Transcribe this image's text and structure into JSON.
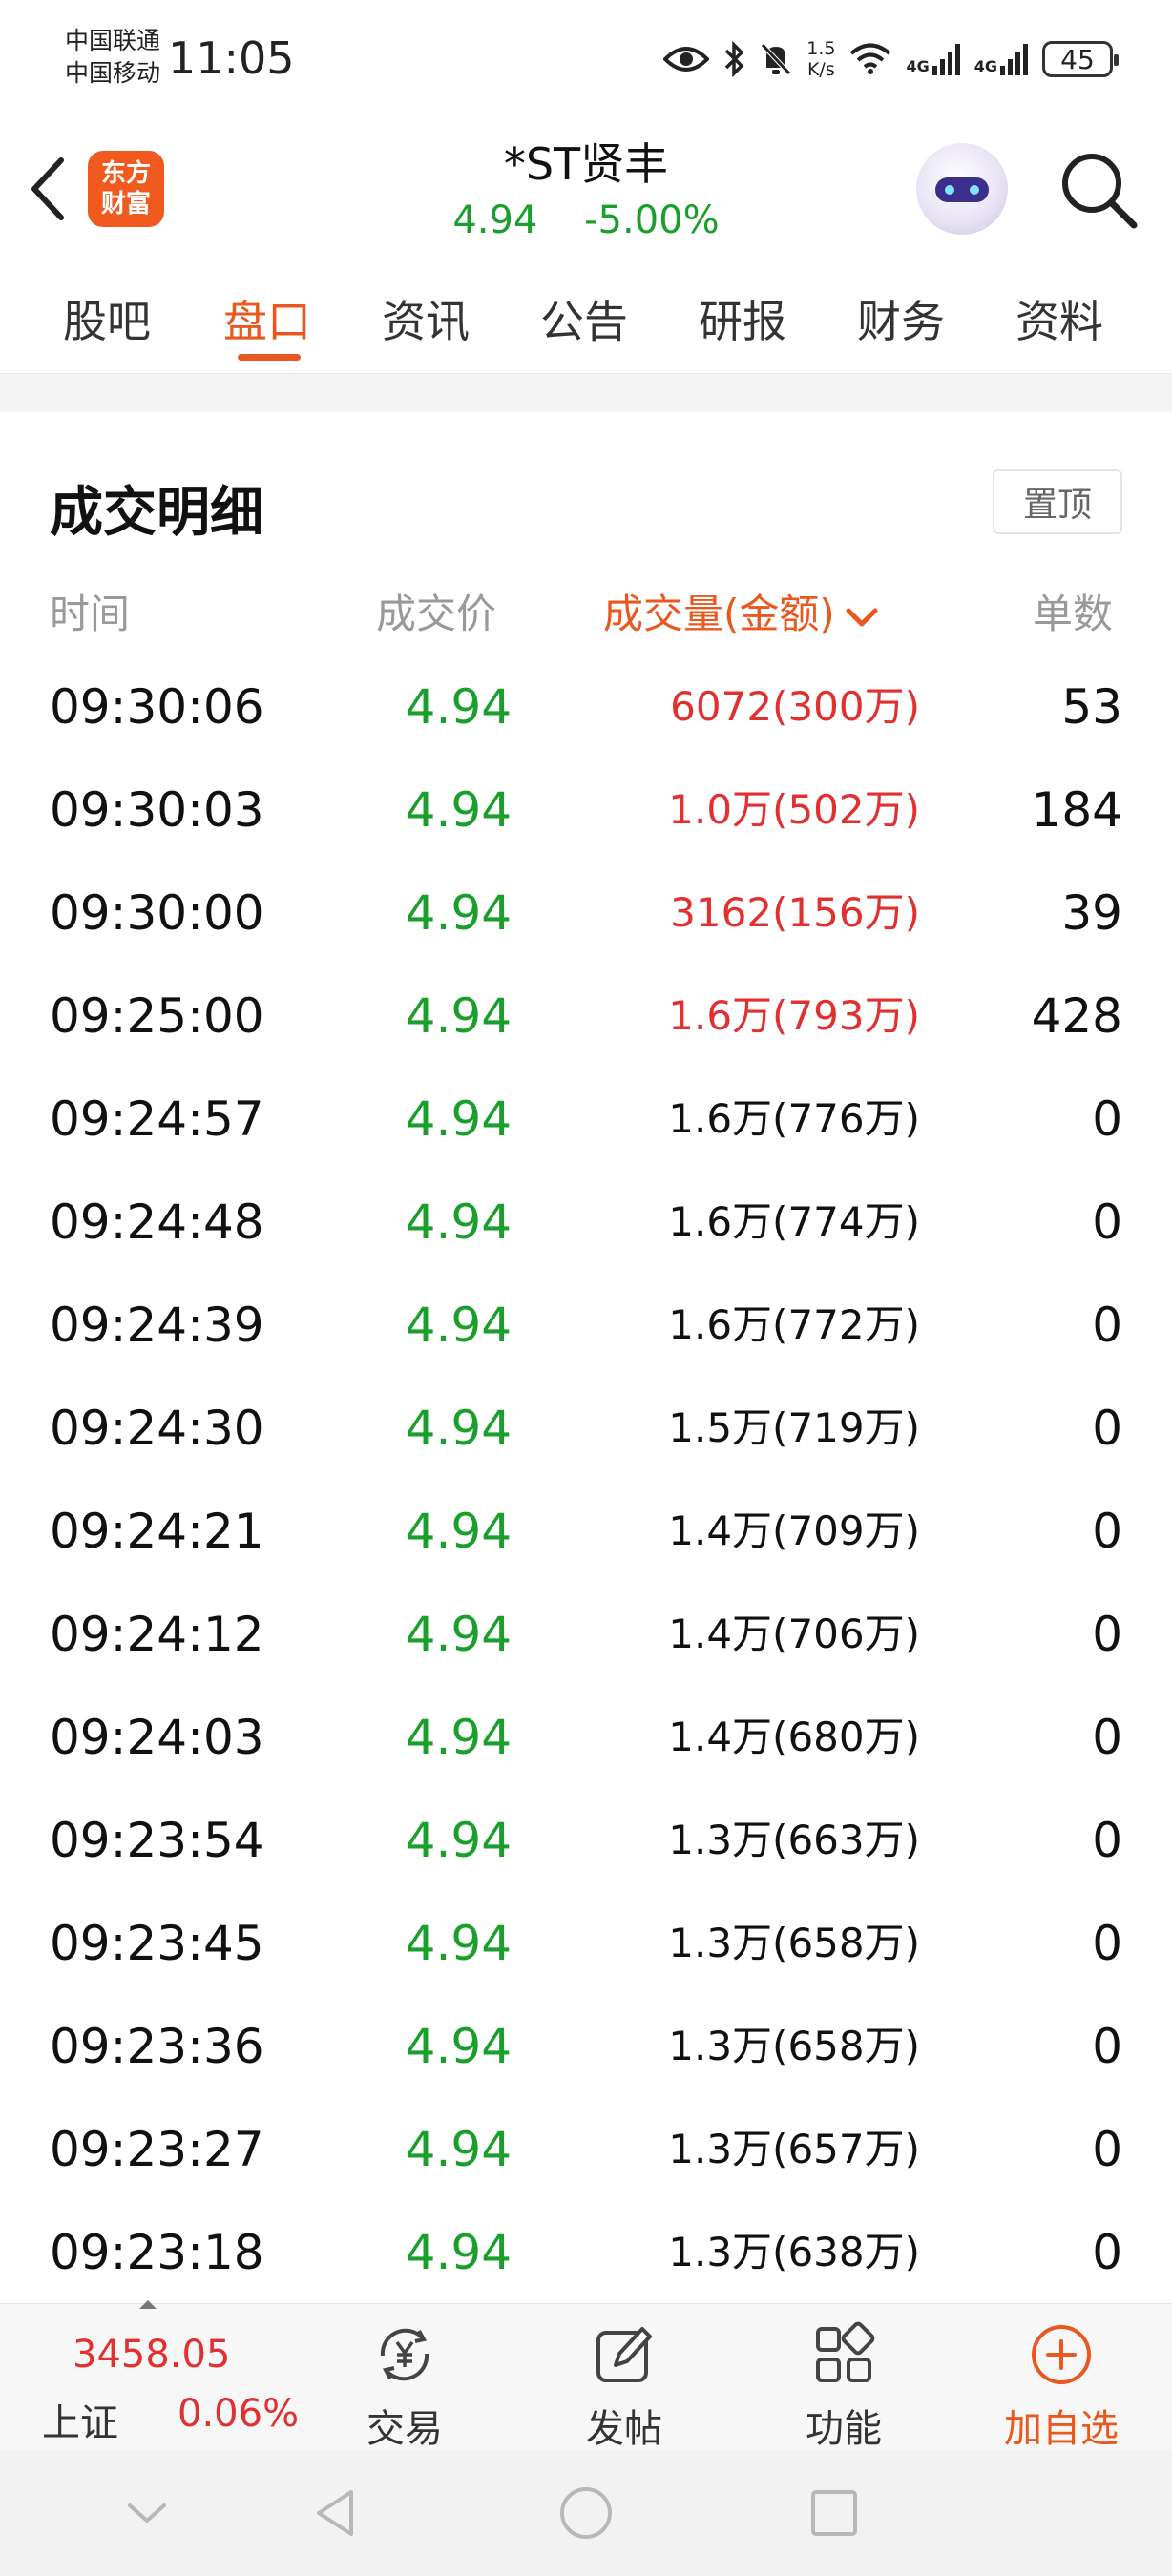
{
  "status_bar": {
    "carrier1": "中国联通",
    "carrier2": "中国移动",
    "time": "11:05",
    "net_speed_value": "1.5",
    "net_speed_unit": "K/s",
    "signal1_label": "4G",
    "signal2_label": "4G",
    "battery": "45"
  },
  "header": {
    "logo_line1": "东方",
    "logo_line2": "财富",
    "stock_name": "*ST贤丰",
    "price": "4.94",
    "change_pct": "-5.00%"
  },
  "tabs": [
    "股吧",
    "盘口",
    "资讯",
    "公告",
    "研报",
    "财务",
    "资料"
  ],
  "active_tab": "盘口",
  "section": {
    "title": "成交明细",
    "pin_label": "置顶",
    "columns": {
      "time": "时间",
      "price": "成交价",
      "volume": "成交量(金额)",
      "count": "单数"
    }
  },
  "trades": [
    {
      "time": "09:30:06",
      "price": "4.94",
      "volume": "6072(300万)",
      "count": "53",
      "highlight": true
    },
    {
      "time": "09:30:03",
      "price": "4.94",
      "volume": "1.0万(502万)",
      "count": "184",
      "highlight": true
    },
    {
      "time": "09:30:00",
      "price": "4.94",
      "volume": "3162(156万)",
      "count": "39",
      "highlight": true
    },
    {
      "time": "09:25:00",
      "price": "4.94",
      "volume": "1.6万(793万)",
      "count": "428",
      "highlight": true
    },
    {
      "time": "09:24:57",
      "price": "4.94",
      "volume": "1.6万(776万)",
      "count": "0",
      "highlight": false
    },
    {
      "time": "09:24:48",
      "price": "4.94",
      "volume": "1.6万(774万)",
      "count": "0",
      "highlight": false
    },
    {
      "time": "09:24:39",
      "price": "4.94",
      "volume": "1.6万(772万)",
      "count": "0",
      "highlight": false
    },
    {
      "time": "09:24:30",
      "price": "4.94",
      "volume": "1.5万(719万)",
      "count": "0",
      "highlight": false
    },
    {
      "time": "09:24:21",
      "price": "4.94",
      "volume": "1.4万(709万)",
      "count": "0",
      "highlight": false
    },
    {
      "time": "09:24:12",
      "price": "4.94",
      "volume": "1.4万(706万)",
      "count": "0",
      "highlight": false
    },
    {
      "time": "09:24:03",
      "price": "4.94",
      "volume": "1.4万(680万)",
      "count": "0",
      "highlight": false
    },
    {
      "time": "09:23:54",
      "price": "4.94",
      "volume": "1.3万(663万)",
      "count": "0",
      "highlight": false
    },
    {
      "time": "09:23:45",
      "price": "4.94",
      "volume": "1.3万(658万)",
      "count": "0",
      "highlight": false
    },
    {
      "time": "09:23:36",
      "price": "4.94",
      "volume": "1.3万(658万)",
      "count": "0",
      "highlight": false
    },
    {
      "time": "09:23:27",
      "price": "4.94",
      "volume": "1.3万(657万)",
      "count": "0",
      "highlight": false
    },
    {
      "time": "09:23:18",
      "price": "4.94",
      "volume": "1.3万(638万)",
      "count": "0",
      "highlight": false
    }
  ],
  "bottom_bar": {
    "index_value": "3458.05",
    "index_name": "上证",
    "index_change": "0.06%",
    "nav": [
      {
        "label": "交易",
        "icon": "trade-yuan-icon"
      },
      {
        "label": "发帖",
        "icon": "edit-post-icon"
      },
      {
        "label": "功能",
        "icon": "function-grid-icon"
      },
      {
        "label": "加自选",
        "icon": "add-circle-icon"
      }
    ]
  },
  "colors": {
    "accent": "#e8581f",
    "down_green": "#1a9e2c",
    "up_red": "#e03030"
  }
}
